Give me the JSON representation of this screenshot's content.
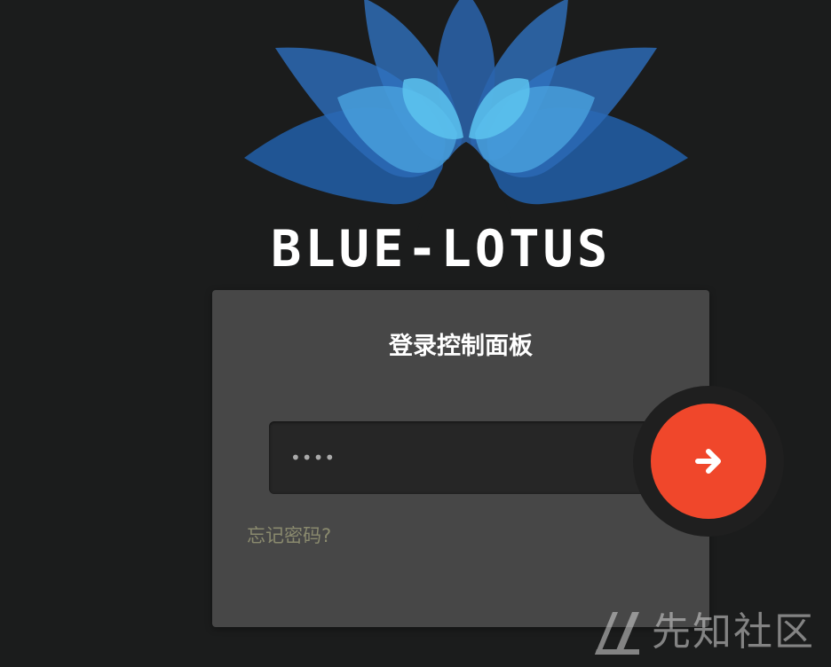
{
  "brand": {
    "logo_text": "BLUE-LOTUS"
  },
  "login": {
    "title": "登录控制面板",
    "password_value": "••••",
    "forgot_label": "忘记密码?"
  },
  "submit": {
    "icon": "arrow-right-icon"
  },
  "watermark": {
    "text": "先知社区"
  },
  "colors": {
    "background": "#1b1c1c",
    "card": "#474747",
    "input": "#262626",
    "accent": "#f0472b",
    "lotus_dark": "#1f4f8f",
    "lotus_light": "#5cc3ef"
  }
}
